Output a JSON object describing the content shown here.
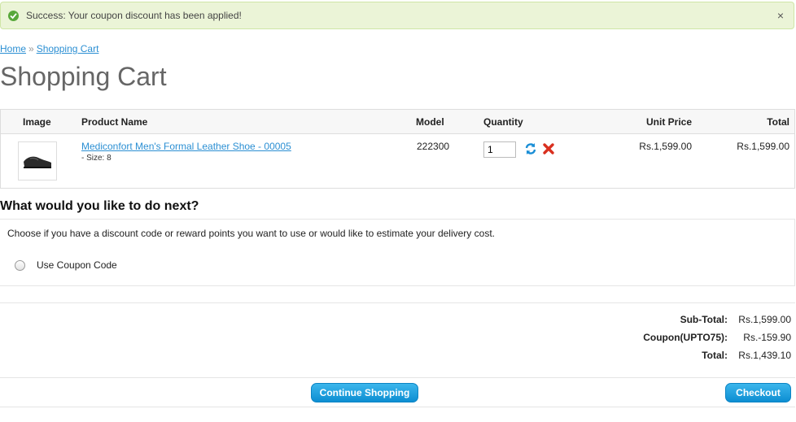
{
  "alert": {
    "message": "Success: Your coupon discount has been applied!",
    "close": "×",
    "color": "#ebf4d7"
  },
  "breadcrumb": {
    "home": "Home",
    "separator": "»",
    "current": "Shopping Cart"
  },
  "page_title": "Shopping Cart",
  "cart": {
    "headers": {
      "image": "Image",
      "name": "Product Name",
      "model": "Model",
      "quantity": "Quantity",
      "unit_price": "Unit Price",
      "total": "Total"
    },
    "items": [
      {
        "name": "Mediconfort Men's Formal Leather Shoe - 00005",
        "option": "- Size: 8",
        "model": "222300",
        "quantity": "1",
        "unit_price": "Rs.1,599.00",
        "total": "Rs.1,599.00"
      }
    ]
  },
  "next": {
    "heading": "What would you like to do next?",
    "description": "Choose if you have a discount code or reward points you want to use or would like to estimate your delivery cost.",
    "option_coupon": "Use Coupon Code"
  },
  "totals": [
    {
      "label": "Sub-Total:",
      "value": "Rs.1,599.00"
    },
    {
      "label": "Coupon(UPTO75):",
      "value": "Rs.-159.90"
    },
    {
      "label": "Total:",
      "value": "Rs.1,439.10"
    }
  ],
  "buttons": {
    "continue": "Continue Shopping",
    "checkout": "Checkout"
  },
  "colors": {
    "accent": "#1a9ddf",
    "link": "#2b8fd3",
    "success": "#58a83a",
    "remove": "#d9301f"
  }
}
